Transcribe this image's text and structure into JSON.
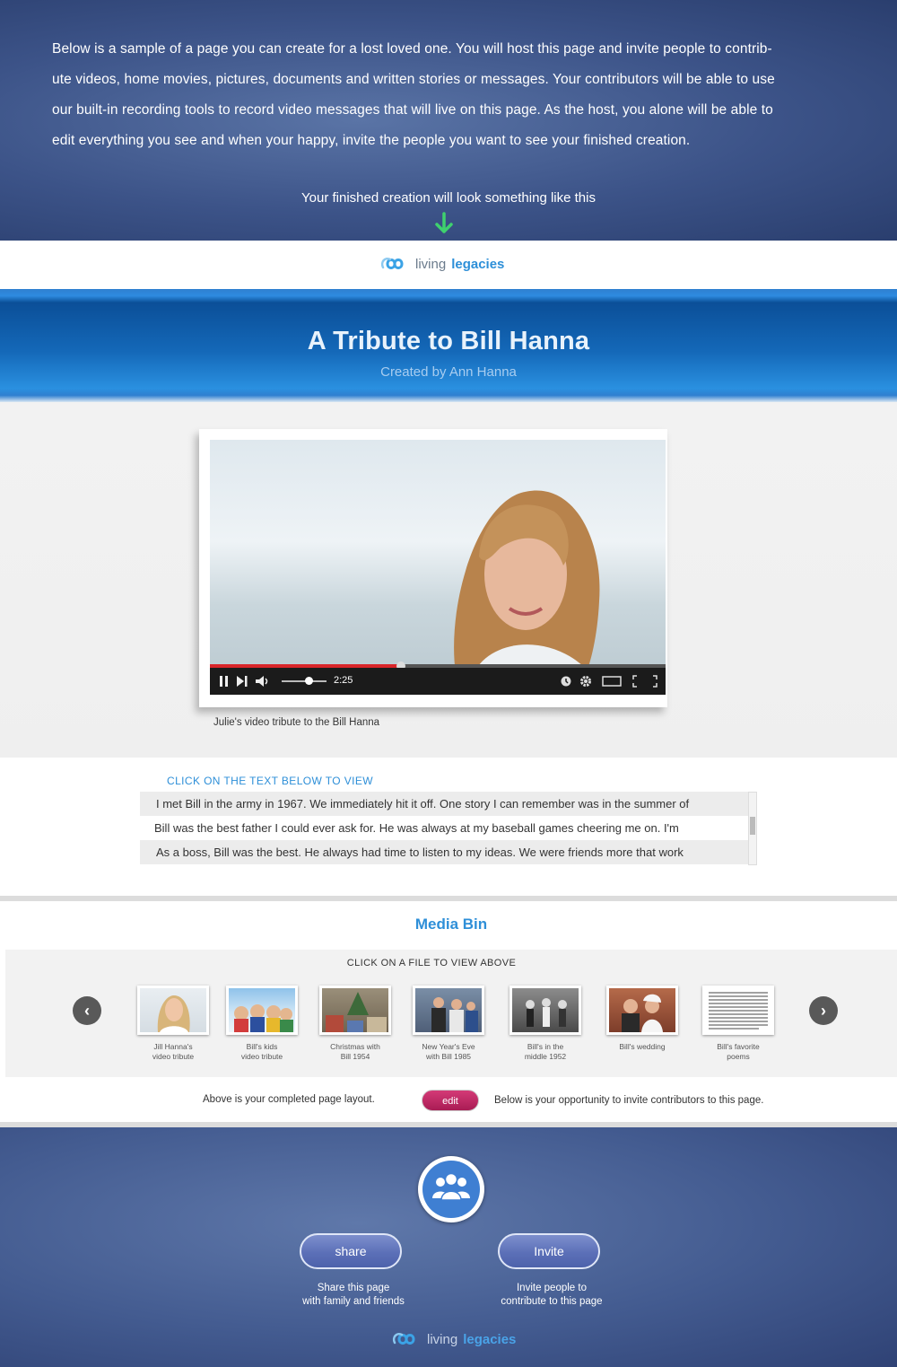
{
  "intro": {
    "lines": [
      "Below is a sample  of a page you can create for  a lost loved one.  You will host this page and invite people to contrib-",
      "ute videos, home movies, pictures, documents and written stories or messages.  Your contributors will be able to use",
      "our built-in recording tools to record video messages that will live on this page. As the host, you alone will be able to",
      "edit everything you see and  when your happy, invite the people you want to see your finished creation."
    ],
    "subline": "Your finished creation will look something like this",
    "arrow_color": "#3fd16e"
  },
  "logo": {
    "word1": "living",
    "word2": "legacies",
    "icon": "infinity-logo-icon"
  },
  "banner": {
    "title": "A Tribute to Bill Hanna",
    "subtitle": "Created by Ann Hanna"
  },
  "video": {
    "time": "2:25",
    "progress": 0.42,
    "volume": 0.6,
    "caption": "Julie's video tribute to the Bill Hanna",
    "icons": [
      "pause-icon",
      "next-icon",
      "volume-icon",
      "clock-icon",
      "settings-icon",
      "theater-icon",
      "fullscreen-icon"
    ]
  },
  "stories": {
    "label": "CLICK ON THE TEXT BELOW TO VIEW",
    "items": [
      "I met Bill in the army in 1967. We immediately hit it off. One story I can remember was in the summer of",
      "Bill was the best father I could ever ask for. He was always at my baseball games cheering me on.  I'm",
      "As a boss, Bill was the best. He always had time to listen to my ideas. We were friends more that work"
    ]
  },
  "media": {
    "title": "Media Bin",
    "hint": "CLICK ON A  FILE TO VIEW ABOVE",
    "items": [
      {
        "line1": "Jill Hanna's",
        "line2": "video tribute"
      },
      {
        "line1": "Bill's kids",
        "line2": "video tribute"
      },
      {
        "line1": "Christmas with",
        "line2": "Bill 1954"
      },
      {
        "line1": "New Year's Eve",
        "line2": "with Bill 1985"
      },
      {
        "line1": "Bill's in the",
        "line2": "middle 1952"
      },
      {
        "line1": "Bill's wedding",
        "line2": ""
      },
      {
        "line1": "Bill's favorite",
        "line2": "poems"
      }
    ]
  },
  "actions": {
    "left": "Above is your completed page layout.",
    "edit": "edit",
    "right": "Below is your opportunity to invite contributors to this page."
  },
  "bottom": {
    "share_label": "share",
    "share_desc_1": "Share this page",
    "share_desc_2": "with family and friends",
    "invite_label": "Invite",
    "invite_desc_1": "Invite people to",
    "invite_desc_2": "contribute to this page"
  },
  "colors": {
    "accent_blue": "#2e8fd8",
    "edit_pink": "#c22c66",
    "progress_red": "#d9252a"
  }
}
